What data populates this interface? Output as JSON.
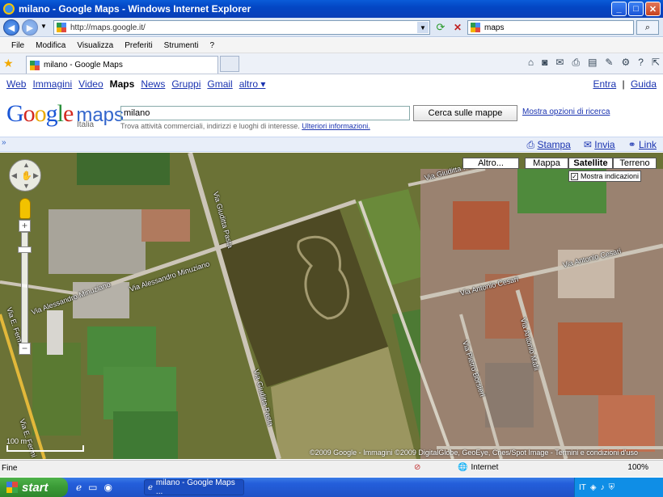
{
  "window": {
    "title": "milano - Google Maps - Windows Internet Explorer",
    "min": "_",
    "max": "□",
    "close": "✕"
  },
  "address": {
    "url": "http://maps.google.it/",
    "search_value": "maps"
  },
  "menu": [
    "File",
    "Modifica",
    "Visualizza",
    "Preferiti",
    "Strumenti",
    "?"
  ],
  "tab": {
    "title": "milano - Google Maps"
  },
  "gnav": {
    "items": [
      "Web",
      "Immagini",
      "Video",
      "Maps",
      "News",
      "Gruppi",
      "Gmail",
      "altro ▾"
    ],
    "signin": "Entra",
    "sep": "|",
    "help": "Guida"
  },
  "logo": {
    "g1": "G",
    "o1": "o",
    "o2": "o",
    "g2": "g",
    "l": "l",
    "e": "e",
    "maps": "maps",
    "country": "Italia"
  },
  "query": {
    "value": "milano",
    "button": "Cerca sulle mappe",
    "options": "Mostra opzioni di ricerca",
    "hint": "Trova attività commerciali, indirizzi e luoghi di interesse.",
    "more": "Ulteriori informazioni."
  },
  "share": {
    "toggle": "»",
    "print": "Stampa",
    "send": "Invia",
    "link": "Link"
  },
  "maptypes": {
    "other": "Altro...",
    "map": "Mappa",
    "satellite": "Satellite",
    "terrain": "Terreno",
    "show_labels": "Mostra indicazioni",
    "check": "✓"
  },
  "streets": [
    "Via Giuditta Pasta",
    "Via Alessandro Minuziano",
    "Via Alessandro Minuziano",
    "Via Antonio Cesari",
    "Via Antonio Cesari",
    "Via Antonio Mafii",
    "Via Pietro Borsieri",
    "Via Giuditta Pasta",
    "Via Giuditta Pasta",
    "Via E. Fermi",
    "Via E. Fermi"
  ],
  "map_text": {
    "copyright": "©2009 Google - Immagini ©2009 DigitalGlobe, GeoEye, Cnes/Spot Image - Termini e condizioni d'uso",
    "scale": "100 m",
    "zoom_in": "+",
    "zoom_out": "−"
  },
  "status": {
    "left": "Fine",
    "zone": "Internet",
    "zoom": "100%"
  },
  "taskbar": {
    "start": "start",
    "task": "milano - Google Maps ...",
    "lang": "IT",
    "clock": ""
  }
}
